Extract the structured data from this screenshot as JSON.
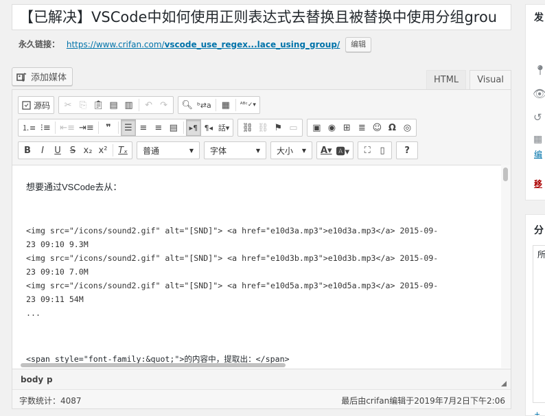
{
  "post": {
    "title": "【已解决】VSCode中如何使用正则表达式去替换且被替换中使用分组grou",
    "permalink_label": "永久链接：",
    "permalink_prefix": "https://www.crifan.com/",
    "permalink_slug": "vscode_use_regex...lace_using_group/",
    "edit_label": "编辑"
  },
  "media": {
    "add_label": "添加媒体"
  },
  "tabs": [
    {
      "label": "HTML"
    },
    {
      "label": "Visual"
    }
  ],
  "toolbar": {
    "source_label": "源码",
    "format_select": "普通",
    "font_select": "字体",
    "size_select": "大小",
    "help_label": "?",
    "icons": [
      "source-icon",
      "cut-icon",
      "copy-icon",
      "paste-icon",
      "paste-text-icon",
      "paste-word-icon",
      "undo-icon",
      "redo-icon",
      "find-icon",
      "replace-icon",
      "toggle-toolbar-icon",
      "spellcheck-icon",
      "ordered-list-icon",
      "unordered-list-icon",
      "outdent-icon",
      "indent-icon",
      "blockquote-icon",
      "align-left-icon",
      "align-center-icon",
      "align-right-icon",
      "align-justify-icon",
      "ltr-icon",
      "rtl-icon",
      "lang-icon",
      "link-icon",
      "unlink-icon",
      "anchor-icon",
      "pagebreak-icon",
      "image-icon",
      "media-icon",
      "table-icon",
      "hr-icon",
      "emoticon-icon",
      "special-char-icon",
      "code-icon",
      "bold-icon",
      "italic-icon",
      "underline-icon",
      "strikethrough-icon",
      "subscript-icon",
      "superscript-icon",
      "clear-format-icon",
      "text-color-icon",
      "bg-color-icon",
      "fullscreen-icon",
      "show-blocks-icon",
      "help-icon"
    ]
  },
  "content": {
    "intro": "想要通过VSCode去从：",
    "code_lines": [
      "<img src=\"/icons/sound2.gif\" alt=\"[SND]\"> <a href=\"e10d3a.mp3\">e10d3a.mp3</a> 2015-09-",
      "23 09:10 9.3M",
      "<img src=\"/icons/sound2.gif\" alt=\"[SND]\"> <a href=\"e10d3b.mp3\">e10d3b.mp3</a> 2015-09-",
      "23 09:10 7.0M",
      "<img src=\"/icons/sound2.gif\" alt=\"[SND]\"> <a href=\"e10d5a.mp3\">e10d5a.mp3</a> 2015-09-",
      "23 09:11 54M",
      "..."
    ],
    "tail": "<span style=\"font-family:&quot;\">的内容中，提取出：</span>"
  },
  "pathbar": {
    "items": [
      "body",
      "p"
    ]
  },
  "status": {
    "word_count": "字数统计：4087",
    "last_edited": "最后由crifan编辑于2019年7月2日下午2:06"
  },
  "sidebar": {
    "publish_title": "发",
    "edit_link": "编",
    "trash_link": "移",
    "category_title": "分",
    "category_tab": "所",
    "more_link": "+"
  },
  "colors": {
    "link": "#0073aa",
    "trash": "#a00",
    "accent": "#23282d"
  }
}
